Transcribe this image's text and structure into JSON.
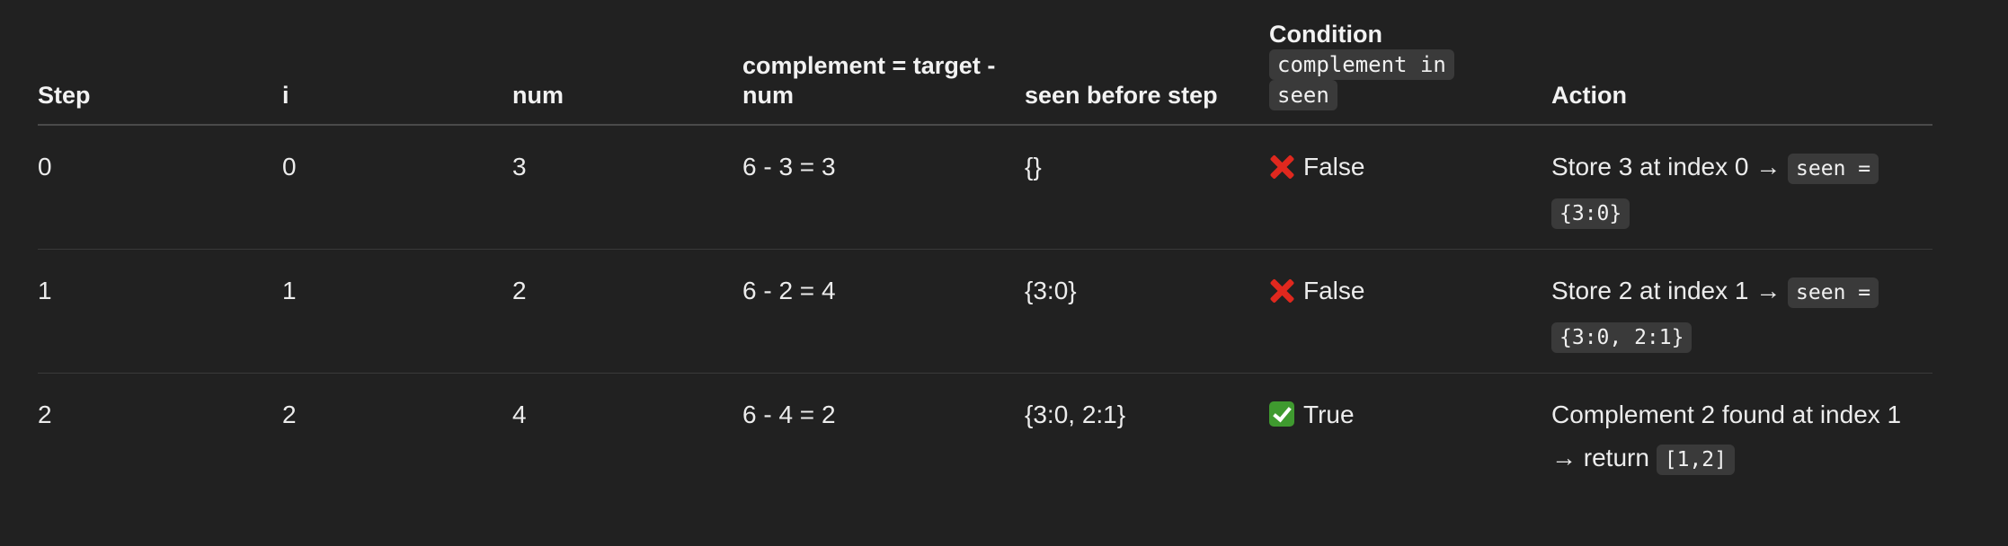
{
  "headers": {
    "step": "Step",
    "i": "i",
    "num": "num",
    "complement": "complement = target - num",
    "seen_before": "seen before step",
    "condition_title": "Condition",
    "condition_code": "complement in seen",
    "action": "Action"
  },
  "rows": [
    {
      "step": "0",
      "i": "0",
      "num": "3",
      "complement": "6 - 3 = 3",
      "seen_before": "{}",
      "condition": {
        "icon": "cross-mark-icon",
        "text": "False"
      },
      "action_text": "Store 3 at index 0 →",
      "action_code": "seen = {3:0}"
    },
    {
      "step": "1",
      "i": "1",
      "num": "2",
      "complement": "6 - 2 = 4",
      "seen_before": "{3:0}",
      "condition": {
        "icon": "cross-mark-icon",
        "text": "False"
      },
      "action_text": "Store 2 at index 1 →",
      "action_code": "seen = {3:0, 2:1}"
    },
    {
      "step": "2",
      "i": "2",
      "num": "4",
      "complement": "6 - 4 = 2",
      "seen_before": "{3:0, 2:1}",
      "condition": {
        "icon": "check-mark-icon",
        "text": "True"
      },
      "action_text": "Complement 2 found at index 1 → return",
      "action_code": "[1,2]"
    }
  ],
  "colors": {
    "background": "#212121",
    "text": "#ececec",
    "code_background": "#3a3a3a",
    "cross_red": "#e0281e",
    "check_green": "#3f9a2f"
  }
}
